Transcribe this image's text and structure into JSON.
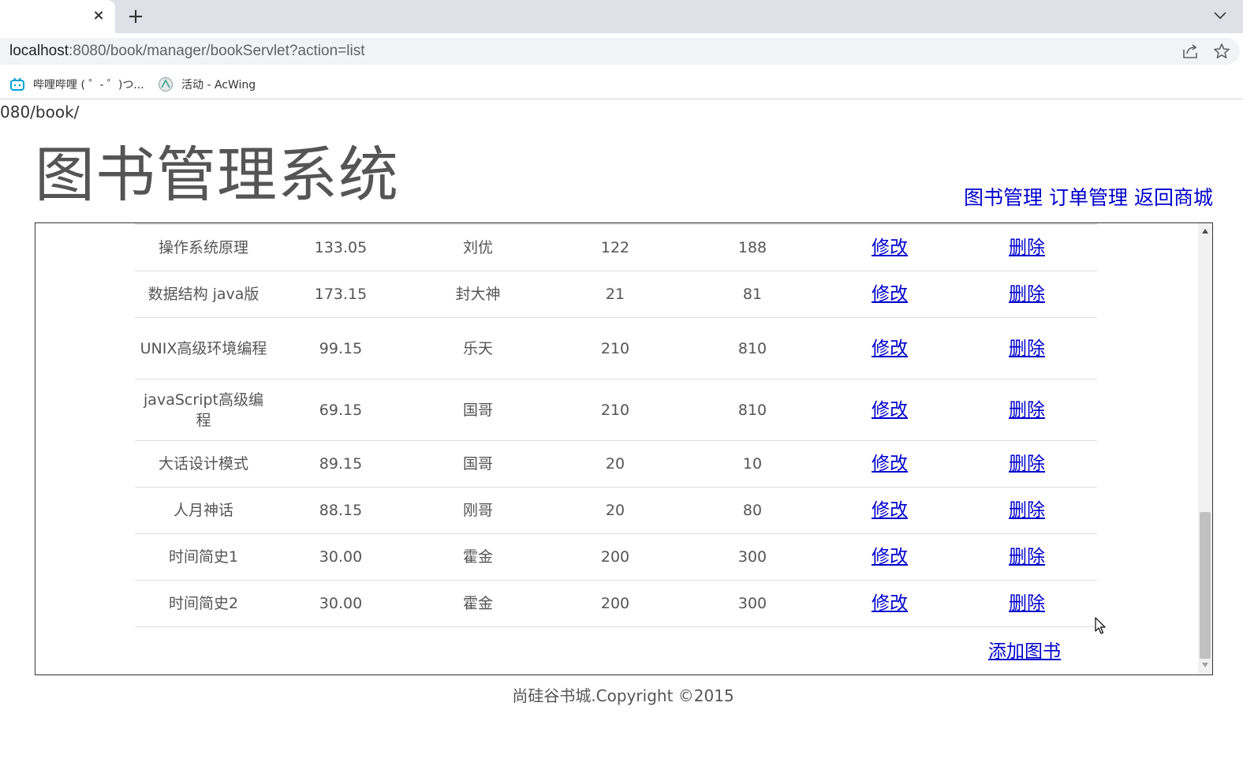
{
  "browser": {
    "tab_close_icon": "×",
    "new_tab_icon": "+",
    "url_host": "localhost",
    "url_rest": ":8080/book/manager/bookServlet?action=list",
    "bookmarks": [
      {
        "icon": "bilibili-icon",
        "label": "哔哩哔哩 ( ゜- ゜)つ..."
      },
      {
        "icon": "acwing-icon",
        "label": "活动 - AcWing"
      }
    ]
  },
  "page": {
    "partial_url": "080/book/",
    "title": "图书管理系统",
    "nav": [
      "图书管理",
      "订单管理",
      "返回商城"
    ],
    "footer": "尚硅谷书城.Copyright ©2015"
  },
  "books": [
    {
      "name": "操作系统原理",
      "price": "133.05",
      "author": "刘优",
      "sales": "122",
      "stock": "188",
      "edit": "修改",
      "del": "删除"
    },
    {
      "name": "数据结构 java版",
      "price": "173.15",
      "author": "封大神",
      "sales": "21",
      "stock": "81",
      "edit": "修改",
      "del": "删除"
    },
    {
      "name": "UNIX高级环境编程",
      "price": "99.15",
      "author": "乐天",
      "sales": "210",
      "stock": "810",
      "edit": "修改",
      "del": "删除"
    },
    {
      "name": "javaScript高级编程",
      "price": "69.15",
      "author": "国哥",
      "sales": "210",
      "stock": "810",
      "edit": "修改",
      "del": "删除"
    },
    {
      "name": "大话设计模式",
      "price": "89.15",
      "author": "国哥",
      "sales": "20",
      "stock": "10",
      "edit": "修改",
      "del": "删除"
    },
    {
      "name": "人月神话",
      "price": "88.15",
      "author": "刚哥",
      "sales": "20",
      "stock": "80",
      "edit": "修改",
      "del": "删除"
    },
    {
      "name": "时间简史1",
      "price": "30.00",
      "author": "霍金",
      "sales": "200",
      "stock": "300",
      "edit": "修改",
      "del": "删除"
    },
    {
      "name": "时间简史2",
      "price": "30.00",
      "author": "霍金",
      "sales": "200",
      "stock": "300",
      "edit": "修改",
      "del": "删除"
    }
  ],
  "add_book": "添加图书"
}
